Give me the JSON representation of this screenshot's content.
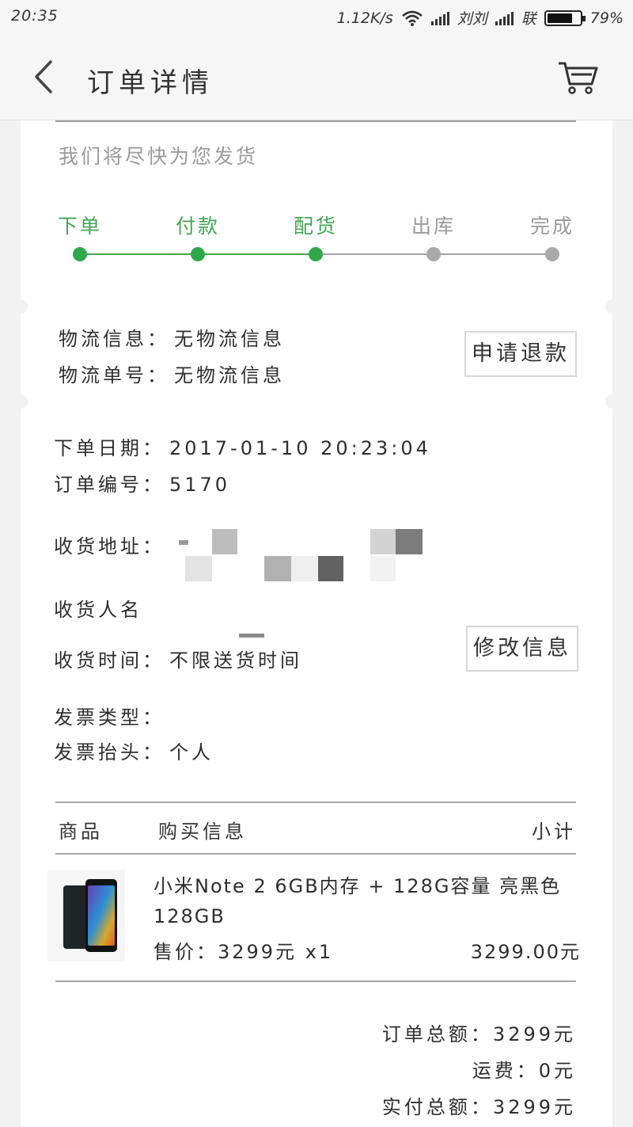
{
  "status_bar": {
    "time": "20:35",
    "net_speed": "1.12K/s",
    "carrier1": "刘刘",
    "carrier2": "联",
    "battery": "79%",
    "battery_level": 0.79
  },
  "header": {
    "title": "订单详情"
  },
  "progress": {
    "hint": "我们将尽快为您发货",
    "steps": [
      {
        "label": "下单",
        "done": true
      },
      {
        "label": "付款",
        "done": true
      },
      {
        "label": "配货",
        "done": true
      },
      {
        "label": "出库",
        "done": false
      },
      {
        "label": "完成",
        "done": false
      }
    ],
    "colors": {
      "done": "#43a552",
      "todo": "#a9a9a9"
    }
  },
  "logistics": {
    "info_label": "物流信息：",
    "info_value": "无物流信息",
    "number_label": "物流单号：",
    "number_value": "无物流信息",
    "refund_button": "申请退款"
  },
  "order": {
    "date_label": "下单日期：",
    "date_value": "2017-01-10 20:23:04",
    "number_label": "订单编号：",
    "number_value": "5170"
  },
  "shipping": {
    "address_label": "收货地址：",
    "name_label": "收货人名",
    "time_label": "收货时间：",
    "time_value": "不限送货时间",
    "edit_button": "修改信息"
  },
  "invoice": {
    "type_label": "发票类型：",
    "type_value": "",
    "title_label": "发票抬头：",
    "title_value": "个人"
  },
  "items_table": {
    "headers": [
      "商品",
      "购买信息",
      "小计"
    ],
    "items": [
      {
        "name": "小米Note 2 6GB内存 + 128G容量 亮黑色 128GB",
        "price": "售价：3299元 x1",
        "subtotal": "3299.00元"
      }
    ]
  },
  "totals": {
    "order_total": "订单总额：3299元",
    "shipping_fee": "运费：0元",
    "paid_total": "实付总额：3299元"
  }
}
